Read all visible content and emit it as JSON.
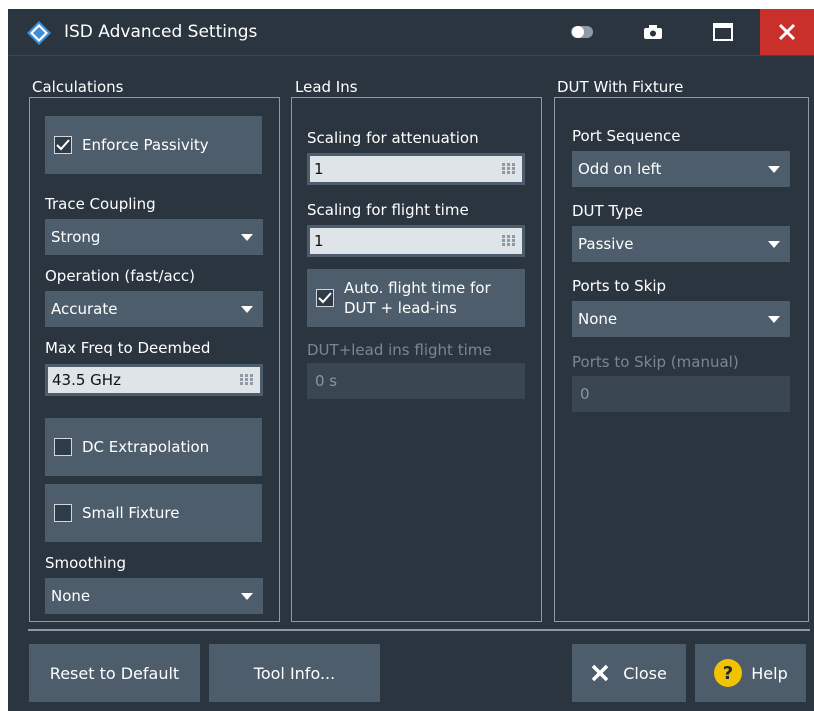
{
  "window": {
    "title": "ISD Advanced Settings"
  },
  "titlebar_icons": [
    "toggle-icon",
    "camera-icon",
    "maximize-icon",
    "close-icon"
  ],
  "calculations": {
    "label": "Calculations",
    "enforce_passivity": {
      "label": "Enforce Passivity",
      "checked": true
    },
    "trace_coupling": {
      "label": "Trace Coupling",
      "value": "Strong"
    },
    "operation": {
      "label": "Operation (fast/acc)",
      "value": "Accurate"
    },
    "max_freq": {
      "label": "Max Freq to Deembed",
      "value": "43.5 GHz"
    },
    "dc_extrapolation": {
      "label": "DC Extrapolation",
      "checked": false
    },
    "small_fixture": {
      "label": "Small Fixture",
      "checked": false
    },
    "smoothing": {
      "label": "Smoothing",
      "value": "None"
    }
  },
  "lead_ins": {
    "label": "Lead Ins",
    "scaling_attenuation": {
      "label": "Scaling for attenuation",
      "value": "1"
    },
    "scaling_flight": {
      "label": "Scaling for flight time",
      "value": "1"
    },
    "auto_flight": {
      "label_line1": "Auto. flight time for",
      "label_line2": "DUT + lead-ins",
      "checked": true
    },
    "dut_flight": {
      "label": "DUT+lead ins flight time",
      "value": "0 s"
    }
  },
  "dut_fixture": {
    "label": "DUT With Fixture",
    "port_sequence": {
      "label": "Port Sequence",
      "value": "Odd on left"
    },
    "dut_type": {
      "label": "DUT Type",
      "value": "Passive"
    },
    "ports_to_skip": {
      "label": "Ports to Skip",
      "value": "None"
    },
    "ports_to_skip_manual": {
      "label": "Ports to Skip (manual)",
      "value": "0"
    }
  },
  "buttons": {
    "reset": "Reset to Default",
    "tool_info": "Tool Info...",
    "close": "Close",
    "help": "Help"
  },
  "colors": {
    "background": "#2a3540",
    "control": "#4d5d6c",
    "close_red": "#c9302c",
    "help_yellow": "#f2c300"
  }
}
